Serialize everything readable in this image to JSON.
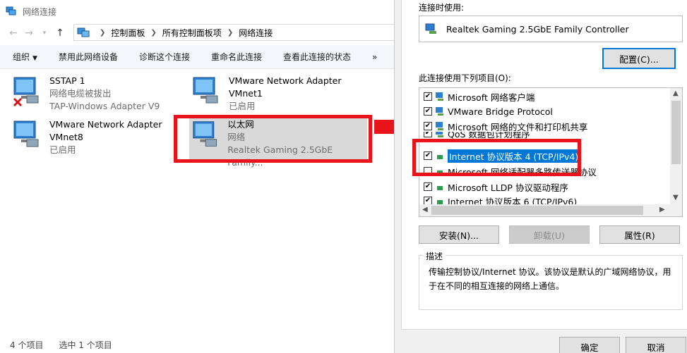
{
  "explorer": {
    "title": "网络连接",
    "breadcrumb": [
      "控制面板",
      "所有控制面板项",
      "网络连接"
    ],
    "toolbar": {
      "organize": "组织",
      "disable": "禁用此网络设备",
      "diagnose": "诊断这个连接",
      "rename": "重命名此连接",
      "status": "查看此连接的状态",
      "more": "»"
    },
    "items": [
      {
        "name": "SSTAP 1",
        "status": "网络电缆被拔出",
        "adapter": "TAP-Windows Adapter V9"
      },
      {
        "name": "VMware Network Adapter",
        "status": "VMnet1",
        "adapter": "已启用"
      },
      {
        "name": "VMware Network Adapter",
        "status": "VMnet8",
        "adapter": "已启用"
      },
      {
        "name": "以太网",
        "status": "网络",
        "adapter": "Realtek Gaming 2.5GbE Family..."
      }
    ],
    "statusbar": {
      "count": "4 个项目",
      "selected": "选中 1 个项目"
    }
  },
  "dialog": {
    "connect_using_label": "连接时使用:",
    "adapter_name": "Realtek Gaming 2.5GbE Family Controller",
    "configure_button": "配置(C)...",
    "items_label": "此连接使用下列项目(O):",
    "list_items": [
      {
        "label": "Microsoft 网络客户端",
        "checked": true
      },
      {
        "label": "VMware Bridge Protocol",
        "checked": true
      },
      {
        "label": "Microsoft 网络的文件和打印机共享",
        "checked": true
      },
      {
        "label": "QoS 数据包计划程序",
        "checked": true
      },
      {
        "label": "Internet 协议版本 4 (TCP/IPv4)",
        "checked": true
      },
      {
        "label": "Microsoft 网络适配器多路传送器协议",
        "checked": false
      },
      {
        "label": "Microsoft LLDP 协议驱动程序",
        "checked": true
      },
      {
        "label": "Internet 协议版本 6 (TCP/IPv6)",
        "checked": true
      }
    ],
    "install_button": "安装(N)...",
    "uninstall_button": "卸载(U)",
    "properties_button": "属性(R)",
    "description_title": "描述",
    "description_text": "传输控制协议/Internet 协议。该协议是默认的广域网络协议，用于在不同的相互连接的网络上通信。",
    "ok_button": "确定",
    "cancel_button": "取消"
  },
  "colors": {
    "highlight": "#e8131b",
    "selection": "#0078d7"
  }
}
